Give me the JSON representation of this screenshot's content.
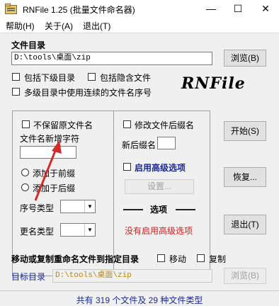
{
  "window": {
    "title": "RNFile 1.25  (批量文件命名器)",
    "minimize_glyph": "—",
    "maximize_glyph": "☐",
    "close_glyph": "✕"
  },
  "menu": [
    "帮助(H)",
    "关于(A)",
    "退出(T)"
  ],
  "file_dir": {
    "label": "文件目录",
    "path": "D:\\tools\\桌面\\zip",
    "browse_label": "浏览(B)",
    "include_subdirs": "包括下级目录",
    "include_hidden": "包括隐含文件",
    "multi_dir_sequence": "多级目录中使用连续的文件名序号",
    "logo": "RNFile"
  },
  "naming": {
    "keep_original_name": "不保留原文件名",
    "new_chars_label": "文件名新增字符",
    "new_chars_value": "",
    "add_before": "添加于前缀",
    "add_after": "添加于后缀",
    "sequence_type_label": "序号类型",
    "rename_type_label": "更名类型"
  },
  "extension": {
    "modify_ext": "修改文件后缀名",
    "new_ext_label": "新后缀名",
    "new_ext_value": "",
    "enable_advanced": "启用高级选项",
    "settings_label": "设置...",
    "options_title": "选项",
    "advanced_status": "没有启用高级选项"
  },
  "actions": {
    "start": "开始(S)",
    "restore": "恢复...",
    "exit": "退出(T)"
  },
  "move_copy": {
    "title": "移动或复制重命名文件到指定目录",
    "move": "移动",
    "copy": "复制",
    "target_label": "目标目录",
    "target_path": "D:\\tools\\桌面\\zip",
    "browse_label": "浏览(B)"
  },
  "status": {
    "text": "共有 319 个文件及 29 种文件类型"
  },
  "colors": {
    "title_accent": "#1a2a9a",
    "advanced_status": "#cc2222",
    "annotation_arrow": "#d42a2a"
  }
}
